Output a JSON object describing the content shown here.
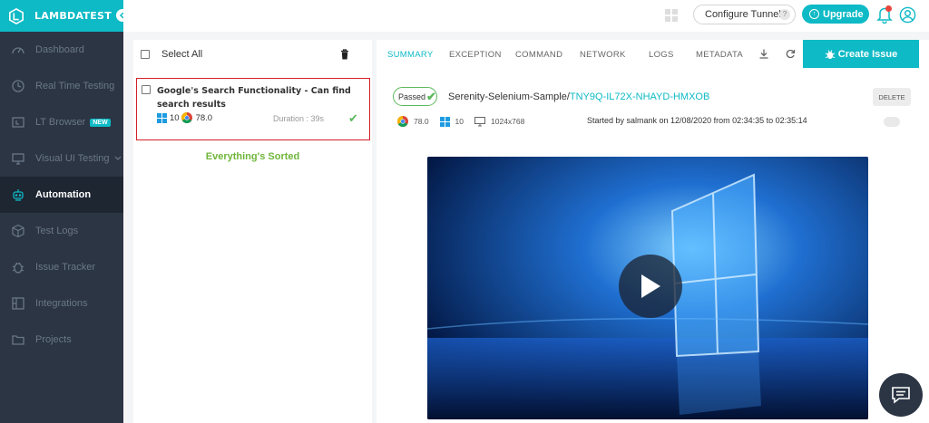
{
  "brand": {
    "name": "LAMBDATEST"
  },
  "sidebar": {
    "items": [
      {
        "label": "Dashboard",
        "icon": "dashboard-icon"
      },
      {
        "label": "Real Time Testing",
        "icon": "clock-icon"
      },
      {
        "label": "LT Browser",
        "icon": "browser-icon",
        "badge": "NEW"
      },
      {
        "label": "Visual UI Testing",
        "icon": "monitor-icon"
      },
      {
        "label": "Automation",
        "icon": "robot-icon",
        "active": true
      },
      {
        "label": "Test Logs",
        "icon": "cube-icon"
      },
      {
        "label": "Issue Tracker",
        "icon": "bug-icon"
      },
      {
        "label": "Integrations",
        "icon": "integrations-icon"
      },
      {
        "label": "Projects",
        "icon": "folder-icon"
      }
    ]
  },
  "topbar": {
    "configure_tunnel": "Configure Tunnel",
    "tunnel_help": "?",
    "upgrade": "Upgrade"
  },
  "list": {
    "select_all": "Select All",
    "tests": [
      {
        "title": "Google's Search Functionality - Can find search results",
        "os_version": "10",
        "browser_version": "78.0",
        "duration": "Duration : 39s",
        "status": "passed"
      }
    ],
    "empty_message": "Everything's Sorted"
  },
  "detail": {
    "tabs": [
      "SUMMARY",
      "EXCEPTION",
      "COMMAND",
      "NETWORK",
      "LOGS",
      "METADATA"
    ],
    "active_tab": "SUMMARY",
    "create_issue": "Create Issue",
    "status": "Passed",
    "build_name": "Serenity-Selenium-Sample/",
    "test_id": "TNY9Q-IL72X-NHAYD-HMXOB",
    "delete": "DELETE",
    "browser_version": "78.0",
    "os_version": "10",
    "resolution": "1024x768",
    "started_by": "Started by salmank on 12/08/2020 from 02:34:35 to 02:35:14"
  },
  "colors": {
    "accent": "#0ebac5",
    "sidebar_bg": "#2b3544",
    "passed": "#5cb85c",
    "highlight_border": "#d32027",
    "sorted_text": "#6fb63b"
  }
}
